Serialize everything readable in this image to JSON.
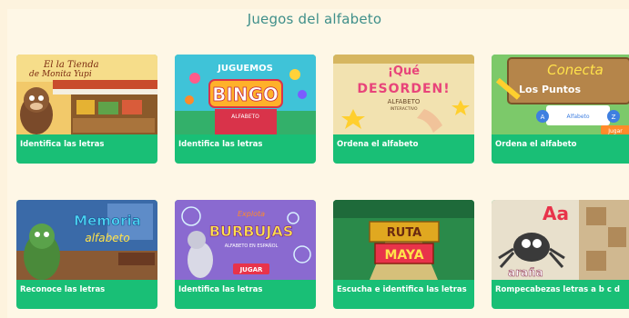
{
  "page": {
    "title": "Juegos del alfabeto"
  },
  "games": [
    {
      "label": "Identifica las letras",
      "art_text": [
        "El la Tienda",
        "de Monita Yupi"
      ]
    },
    {
      "label": "Identifica las letras",
      "art_text": [
        "JUGUEMOS",
        "BINGO",
        "ALFABETO"
      ]
    },
    {
      "label": "Ordena el alfabeto",
      "art_text": [
        "¡Qué",
        "DESORDEN!",
        "ALFABETO",
        "INTERACTIVO"
      ]
    },
    {
      "label": "Ordena el alfabeto",
      "art_text": [
        "Conecta",
        "Los Puntos",
        "A",
        "Alfabeto",
        "Z",
        "Jugar"
      ]
    },
    {
      "label": "Reconoce las letras",
      "art_text": [
        "Memoria",
        "alfabeto"
      ]
    },
    {
      "label": "Identifica las letras",
      "art_text": [
        "Explota",
        "BURBUJAS",
        "ALFABETO EN ESPAÑOL",
        "JUGAR"
      ]
    },
    {
      "label": "Escucha e identifica las letras",
      "art_text": [
        "RUTA",
        "MAYA"
      ]
    },
    {
      "label": "Rompecabezas letras a b c d",
      "art_text": [
        "Aa",
        "araña"
      ]
    }
  ]
}
